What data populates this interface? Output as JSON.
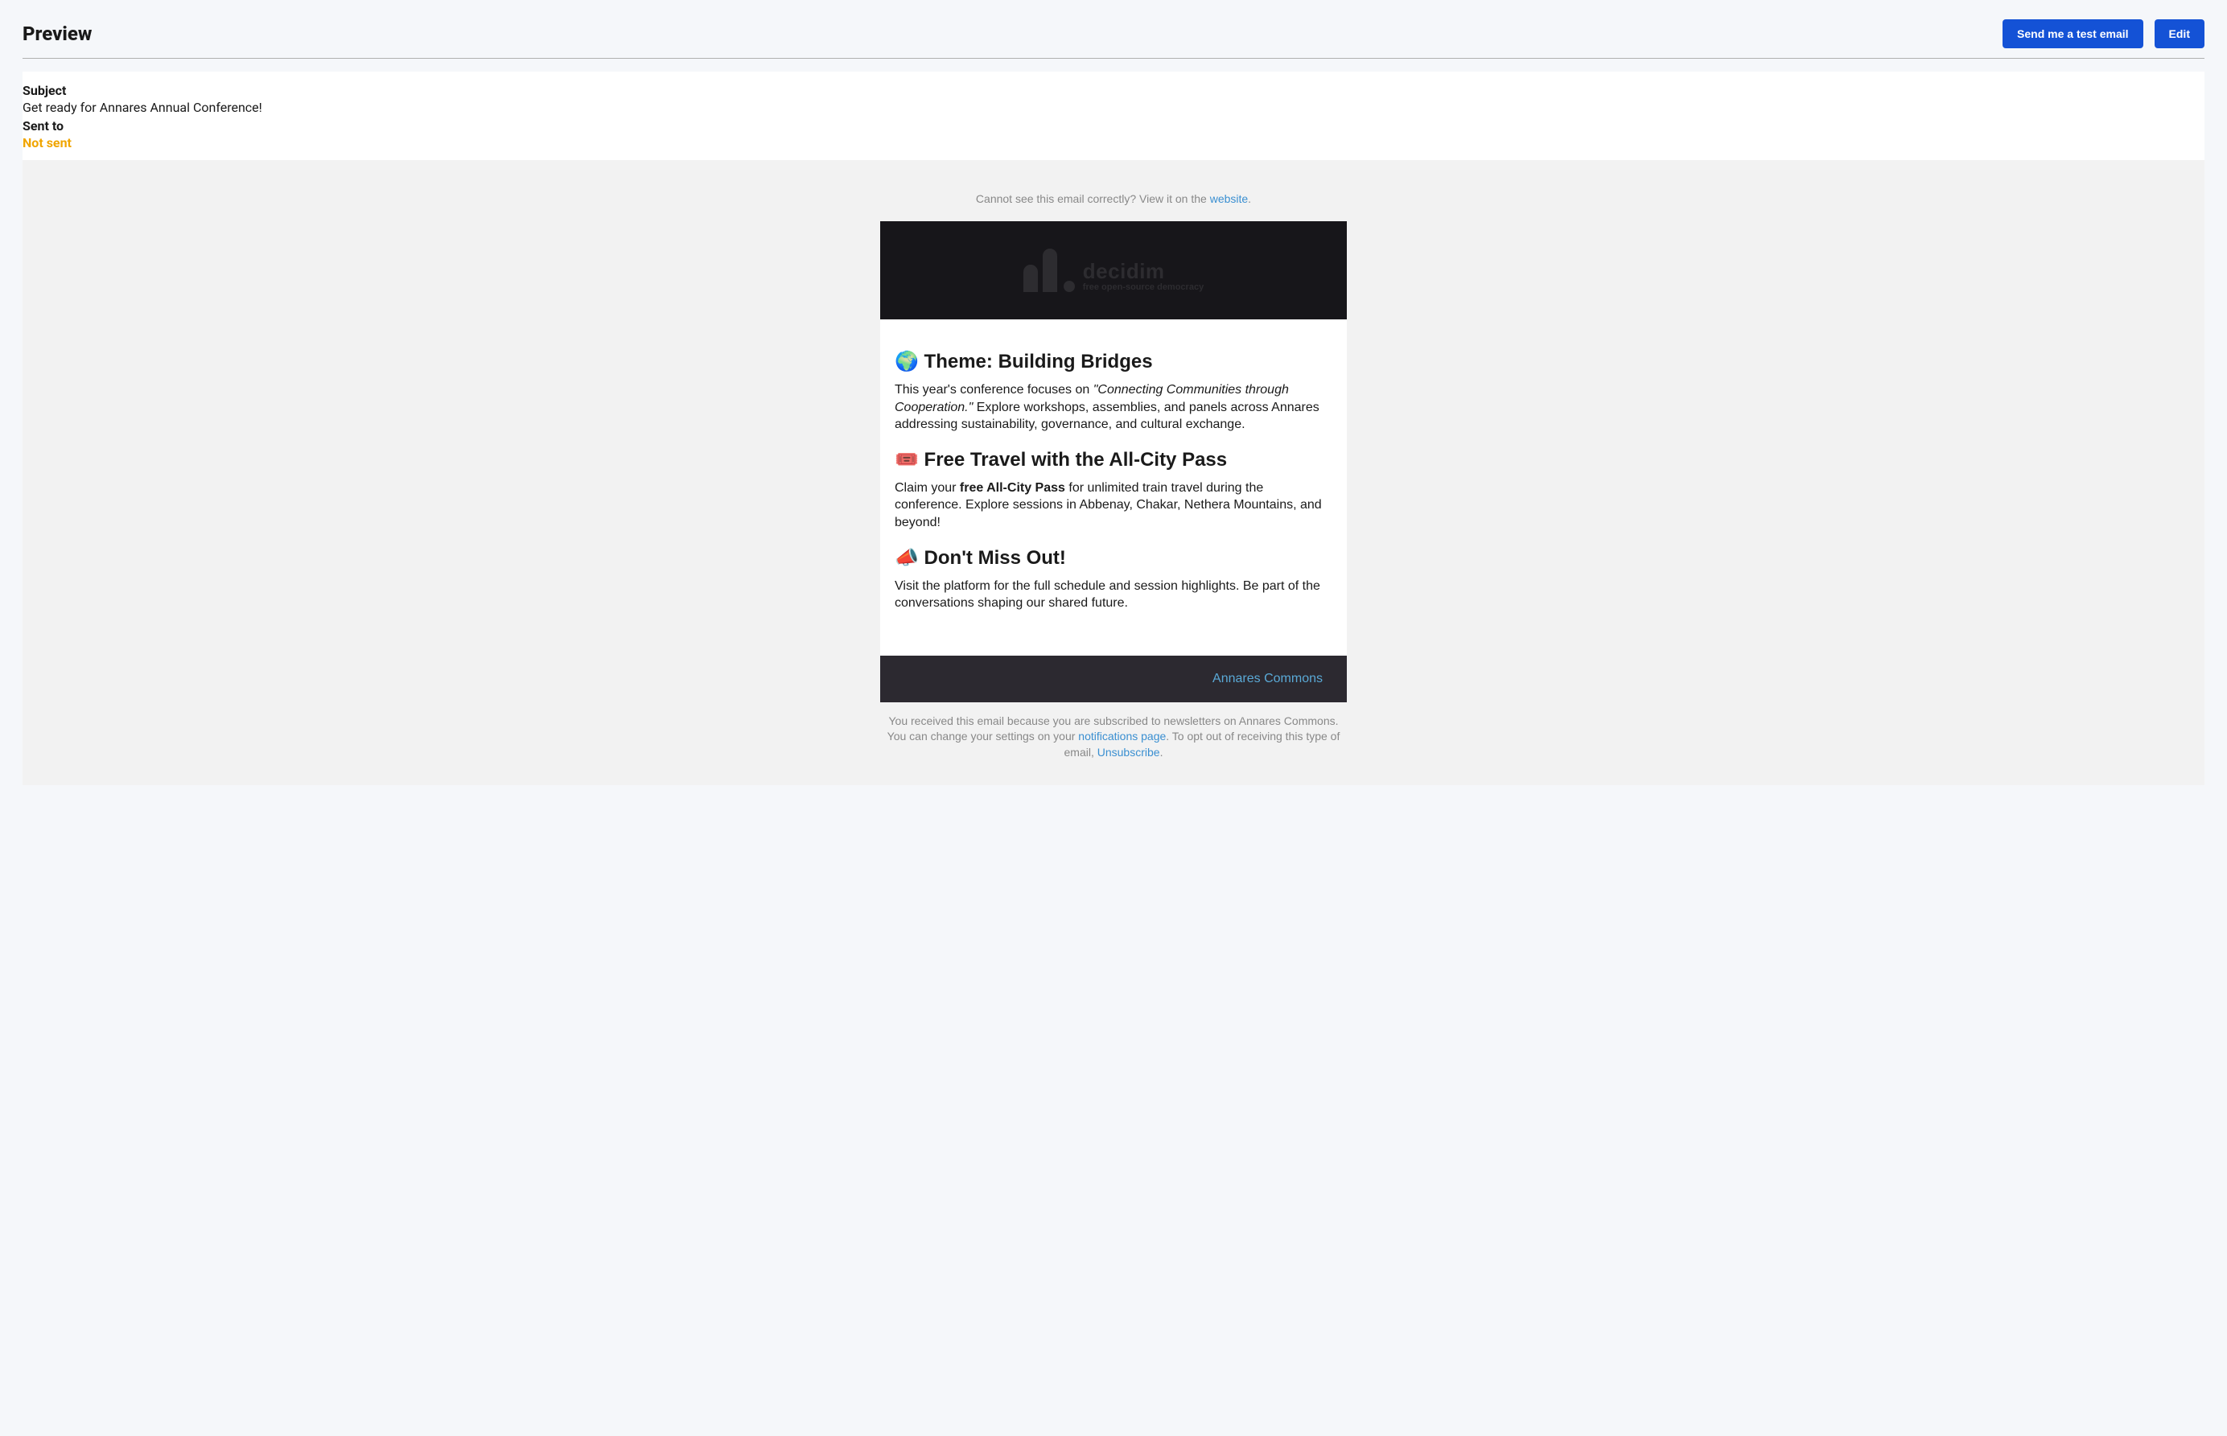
{
  "header": {
    "title": "Preview",
    "test_btn": "Send me a test email",
    "edit_btn": "Edit"
  },
  "meta": {
    "subject_label": "Subject",
    "subject_value": "Get ready for Annares Annual Conference!",
    "sent_to_label": "Sent to",
    "sent_status": "Not sent"
  },
  "email": {
    "fallback_pre": "Cannot see this email correctly? View it on the ",
    "fallback_link": "website",
    "fallback_post": ".",
    "logo": {
      "name": "decidim",
      "tag": "free open-source democracy"
    },
    "sections": [
      {
        "heading": "🌍 Theme: Building Bridges",
        "para_pre": "This year's conference focuses on ",
        "para_quote": "\"Connecting Communities through Cooperation.\"",
        "para_post": " Explore workshops, assemblies, and panels across Annares addressing sustainability, governance, and cultural exchange."
      },
      {
        "heading": "🎟️ Free Travel with the All-City Pass",
        "para_pre": "Claim your ",
        "para_bold": "free All-City Pass",
        "para_post": " for unlimited train travel during the conference. Explore sessions in Abbenay, Chakar, Nethera Mountains, and beyond!"
      },
      {
        "heading": "📣 Don't Miss Out!",
        "para_plain": "Visit the platform for the full schedule and session highlights. Be part of the conversations shaping our shared future."
      }
    ],
    "footer_link": "Annares Commons",
    "unsub": {
      "pre": "You received this email because you are subscribed to newsletters on Annares Commons. You can change your settings on your ",
      "link1": "notifications page",
      "mid": ". To opt out of receiving this type of email, ",
      "link2": "Unsubscribe",
      "post": "."
    }
  }
}
